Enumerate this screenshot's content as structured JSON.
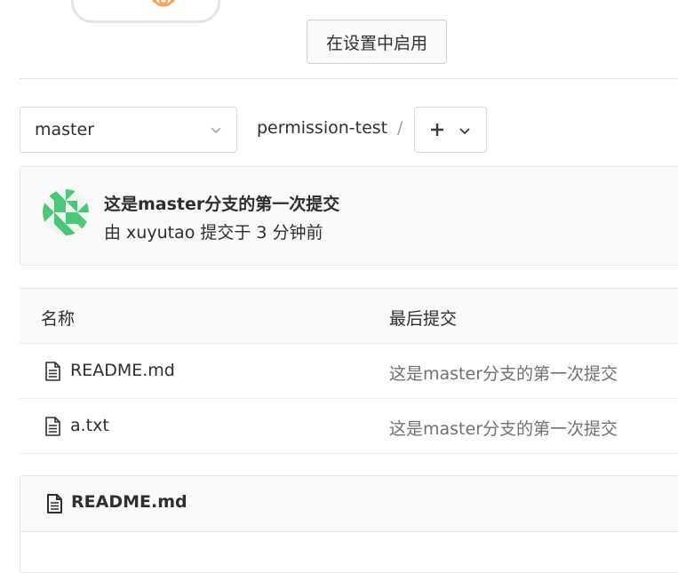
{
  "settings": {
    "enable_button": "在设置中启用"
  },
  "repo": {
    "branch": "master",
    "path": "permission-test",
    "path_separator": "/"
  },
  "last_commit": {
    "title": "这是master分支的第一次提交",
    "meta": "由 xuyutao 提交于 3 分钟前",
    "avatar_color": "#4cc776"
  },
  "file_table": {
    "headers": {
      "name": "名称",
      "last_commit": "最后提交"
    },
    "rows": [
      {
        "name": "README.md",
        "commit": "这是master分支的第一次提交"
      },
      {
        "name": "a.txt",
        "commit": "这是master分支的第一次提交"
      }
    ]
  },
  "readme": {
    "title": "README.md"
  },
  "icons": {
    "branch_chevron": "chevron-down-icon",
    "add": "plus-icon",
    "add_chevron": "chevron-down-icon",
    "file": "file-icon",
    "illustration": "gear-icon"
  }
}
